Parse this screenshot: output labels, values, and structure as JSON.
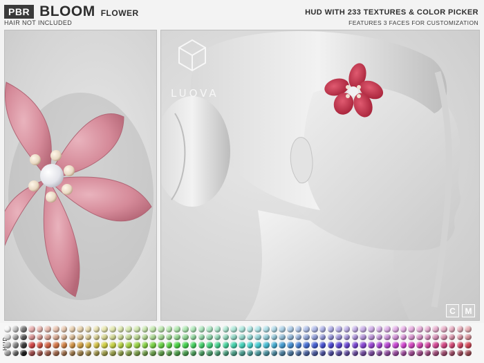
{
  "header": {
    "badge": "PBR",
    "title": "BLOOM",
    "subtitle": "FLOWER",
    "note": "HAIR NOT INCLUDED",
    "tagline": "HUD WITH 233 TEXTURES & COLOR PICKER",
    "features": "FEATURES 3 FACES FOR CUSTOMIZATION"
  },
  "preview": {
    "logo_text": "LUOVA",
    "flower_left_color": "#d98c9b",
    "flower_right_color": "#c8334b",
    "pearl_color": "#f1f1f3"
  },
  "buttons": {
    "color_label": "C",
    "material_label": "M"
  },
  "palette": {
    "hud_label": "HUD",
    "rows": 4,
    "columns": 58
  }
}
